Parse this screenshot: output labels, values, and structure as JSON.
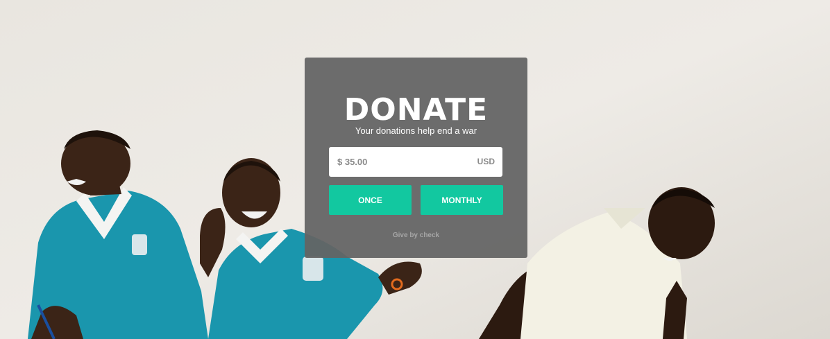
{
  "donate": {
    "title": "DONATE",
    "subtitle": "Your donations help end a war",
    "amount_value": "$ 35.00",
    "currency": "USD",
    "once_label": "ONCE",
    "monthly_label": "MONTHLY",
    "give_by_check_label": "Give by check"
  },
  "colors": {
    "accent": "#12c8a0",
    "card": "#646464",
    "uniform": "#1a96ad"
  }
}
